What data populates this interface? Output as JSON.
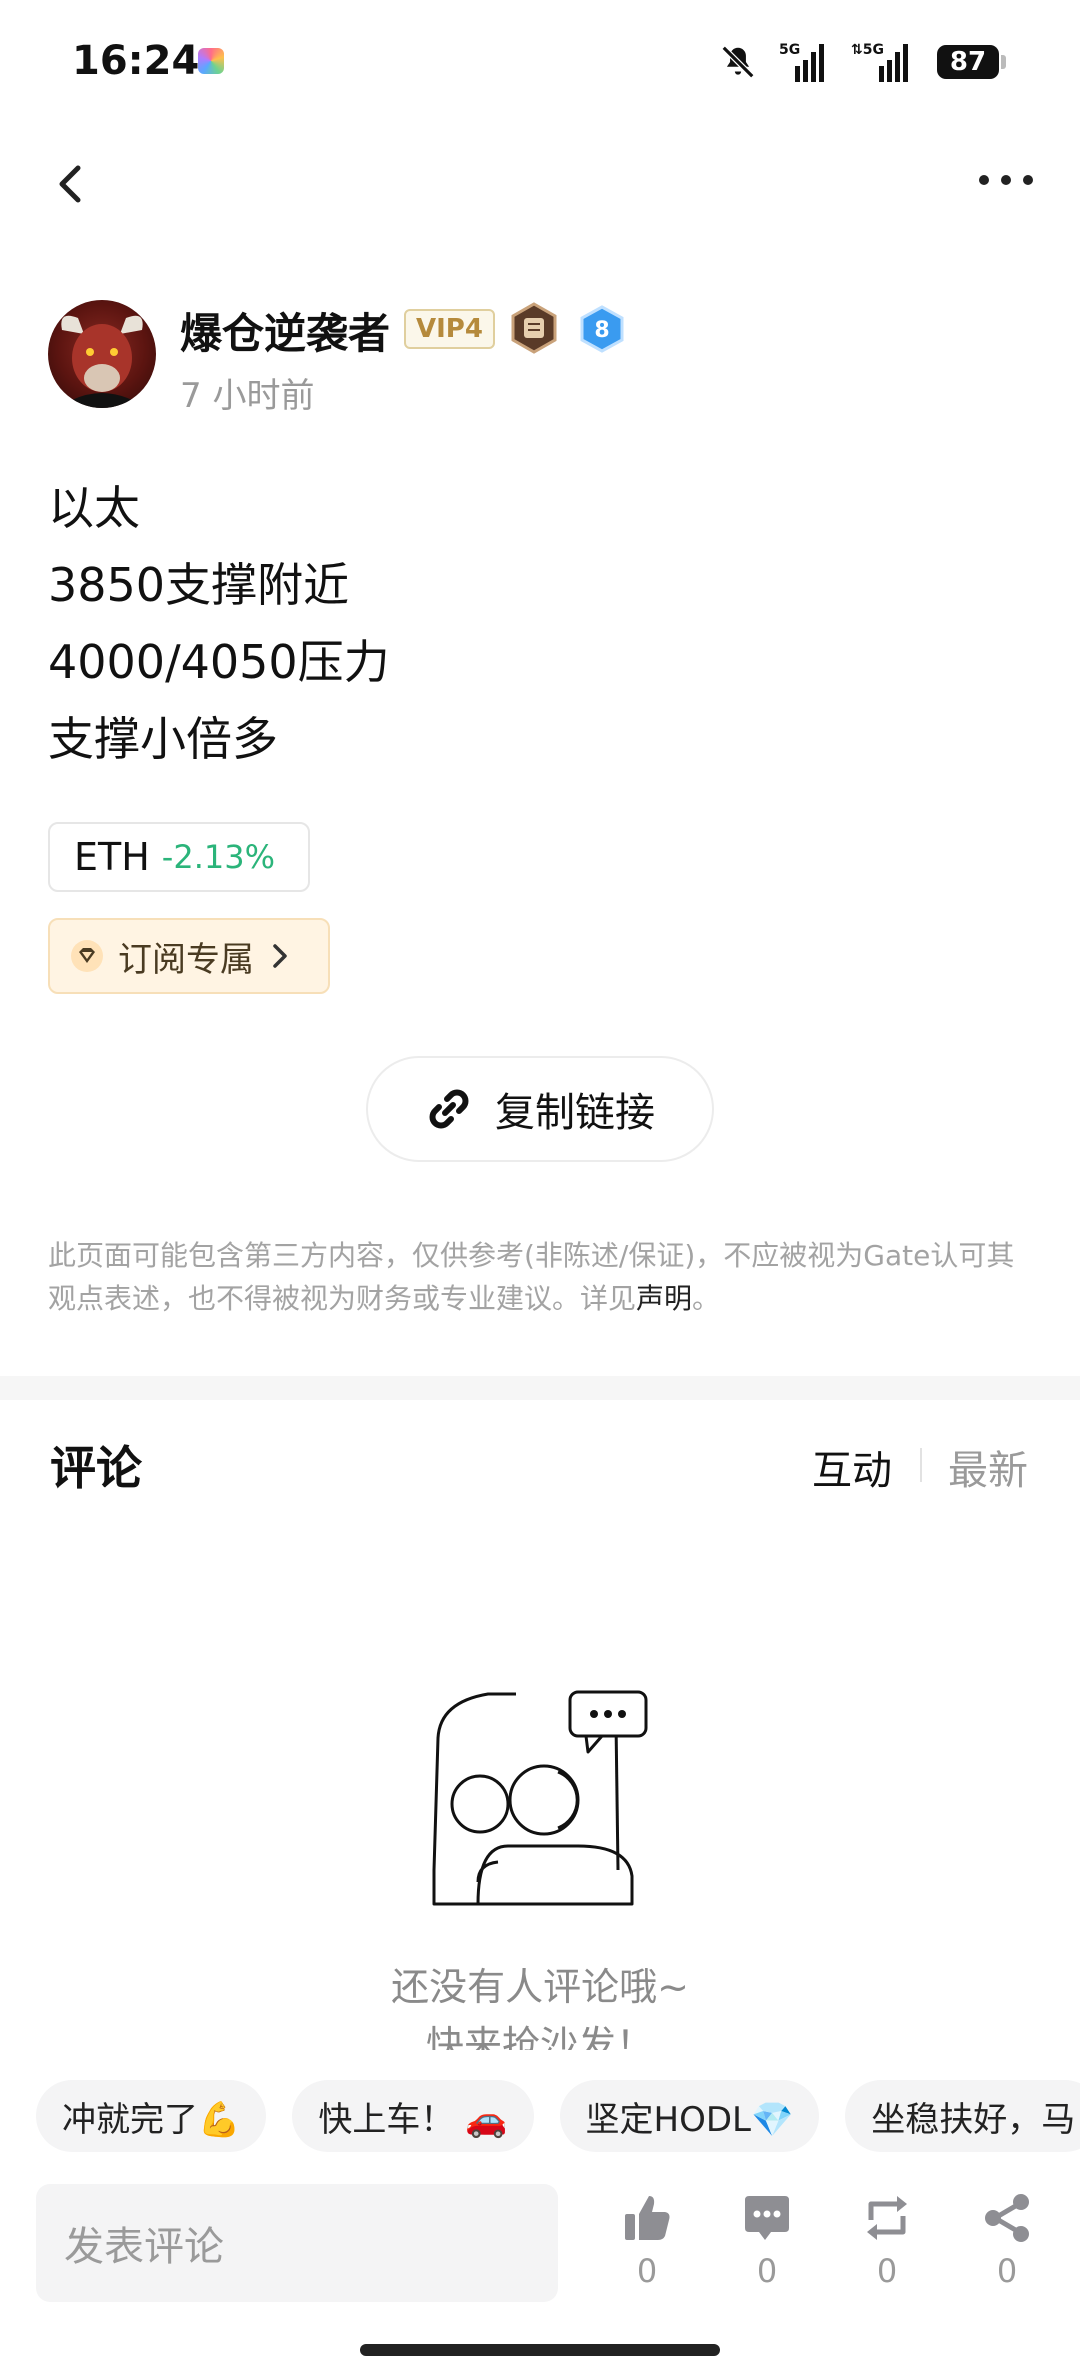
{
  "status_bar": {
    "time": "16:24",
    "battery": "87",
    "icons": [
      "app-icon",
      "mute-icon",
      "signal-5g-icon",
      "signal-5g-icon",
      "battery-icon"
    ]
  },
  "header": {
    "back_icon": "chevron-left-icon",
    "more_icon": "more-dots-icon"
  },
  "author": {
    "name": "爆仓逆袭者",
    "vip": "VIP4",
    "level": "8",
    "time_ago": "7 小时前"
  },
  "post": {
    "lines": [
      "以太",
      "3850支撑附近",
      "4000/4050压力",
      "支撑小倍多"
    ]
  },
  "ticker": {
    "symbol": "ETH",
    "change": "-2.13%",
    "change_color": "#2bb47a"
  },
  "subscription": {
    "label": "订阅专属"
  },
  "copy_link": {
    "label": "复制链接"
  },
  "disclaimer": {
    "text": "此页面可能包含第三方内容，仅供参考(非陈述/保证)，不应被视为Gate认可其观点表述，也不得被视为财务或专业建议。详见",
    "link": "声明",
    "end": "。"
  },
  "comments": {
    "title": "评论",
    "sort_hot": "互动",
    "sort_new": "最新",
    "empty_line1": "还没有人评论哦~",
    "empty_line2": "快来抢沙发！"
  },
  "quick_replies": [
    "冲就完了💪",
    "快上车！ 🚗",
    "坚定HODL💎",
    "坐稳扶好，马"
  ],
  "bottom_bar": {
    "input_placeholder": "发表评论",
    "like_count": "0",
    "comment_count": "0",
    "repost_count": "0",
    "share_count": "0"
  },
  "colors": {
    "accent_positive": "#2bb47a",
    "vip_gold": "#b58a3c",
    "level_blue": "#3a9bf0"
  }
}
